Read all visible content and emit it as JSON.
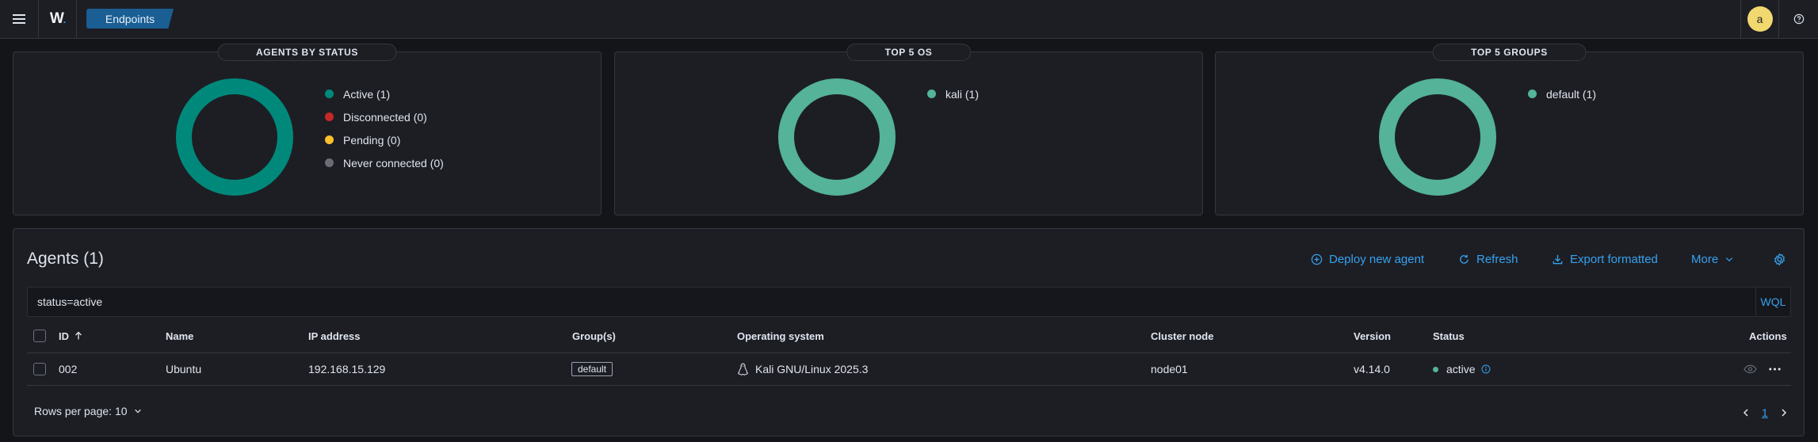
{
  "header": {
    "breadcrumb": "Endpoints",
    "logo_text": "W",
    "avatar_initial": "a"
  },
  "panels": [
    {
      "title": "AGENTS BY STATUS",
      "legend": [
        {
          "label": "Active (1)",
          "color": "#00897b"
        },
        {
          "label": "Disconnected (0)",
          "color": "#c62828"
        },
        {
          "label": "Pending (0)",
          "color": "#fbc02d"
        },
        {
          "label": "Never connected (0)",
          "color": "#6a6d75"
        }
      ],
      "donut_color": "#00897b"
    },
    {
      "title": "TOP 5 OS",
      "legend": [
        {
          "label": "kali (1)",
          "color": "#54b399"
        }
      ],
      "donut_color": "#54b399"
    },
    {
      "title": "TOP 5 GROUPS",
      "legend": [
        {
          "label": "default (1)",
          "color": "#54b399"
        }
      ],
      "donut_color": "#54b399"
    }
  ],
  "agents": {
    "title": "Agents (1)",
    "actions": {
      "deploy": "Deploy new agent",
      "refresh": "Refresh",
      "export": "Export formatted",
      "more": "More"
    },
    "search": {
      "value": "status=active",
      "mode": "WQL"
    },
    "columns": [
      "ID",
      "Name",
      "IP address",
      "Group(s)",
      "Operating system",
      "Cluster node",
      "Version",
      "Status",
      "Actions"
    ],
    "rows": [
      {
        "id": "002",
        "name": "Ubuntu",
        "ip": "192.168.15.129",
        "group": "default",
        "os": "Kali GNU/Linux 2025.3",
        "node": "node01",
        "version": "v4.14.0",
        "status": "active"
      }
    ],
    "rows_per_page": "Rows per page: 10",
    "current_page": "1"
  },
  "colors": {
    "accent": "#36a2ef",
    "active": "#54b399",
    "background": "#141519",
    "panel": "#1d1e24"
  }
}
